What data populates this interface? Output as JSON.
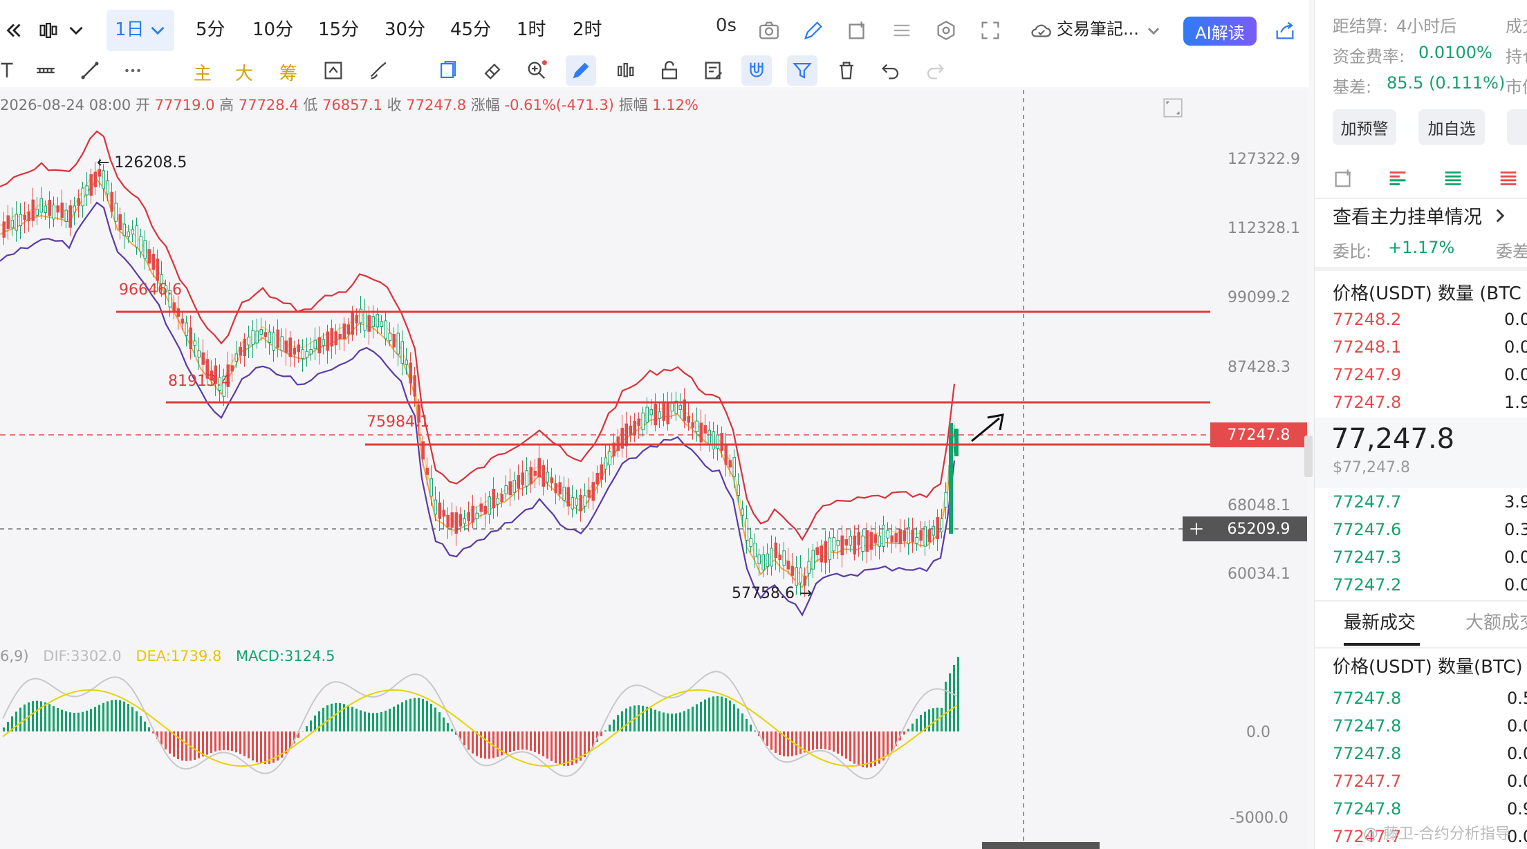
{
  "toolbar": {
    "timeframes": [
      "1日",
      "5分",
      "10分",
      "15分",
      "30分",
      "45分",
      "1时",
      "2时",
      "0s"
    ],
    "active_timeframe": "1日",
    "trade_notes_label": "交易筆記...",
    "ai_button": "AI解读"
  },
  "toolbar2": {
    "indicators": [
      "主",
      "大",
      "筹"
    ]
  },
  "candle_info": {
    "datetime": "2026-08-24 08:00",
    "open_label": "开",
    "open": "77719.0",
    "high_label": "高",
    "high": "77728.4",
    "low_label": "低",
    "low": "76857.1",
    "close_label": "收",
    "close": "77247.8",
    "change_label": "涨幅",
    "change": "-0.61%(-471.3)",
    "amplitude_label": "振幅",
    "amplitude": "1.12%"
  },
  "price_axis": [
    "127322.9",
    "112328.1",
    "99099.2",
    "87428.3",
    "68048.1",
    "60034.1"
  ],
  "price_badges": {
    "current": "77247.8",
    "crosshair": "65209.9"
  },
  "annotations": {
    "high_mark": "← 126208.5",
    "level1": "96646.6",
    "level2": "81913.4",
    "level3": "75984.1",
    "low_mark": "57758.6 →"
  },
  "macd": {
    "params": "6,9)",
    "dif": "DIF:3302.0",
    "dea": "DEA:1739.8",
    "macd": "MACD:3124.5",
    "axis": [
      "0.0",
      "-5000.0"
    ]
  },
  "right_panel": {
    "settlement_label": "距结算:",
    "settlement_value": "4小时后",
    "funding_label": "资金费率:",
    "funding_value": "0.0100%",
    "basis_label": "基差:",
    "basis_value": "85.5 (0.111%)",
    "col_right_labels": [
      "成交",
      "持仓",
      "市值"
    ],
    "buttons": [
      "加预警",
      "加自选"
    ],
    "orderbook_link": "查看主力挂单情况",
    "ratio_label": "委比:",
    "ratio_value": "+1.17%",
    "ratio_right": "委差",
    "ob_header": "价格(USDT) 数量 (BTC",
    "asks": [
      {
        "price": "77248.2",
        "qty": "0.0"
      },
      {
        "price": "77248.1",
        "qty": "0.0"
      },
      {
        "price": "77247.9",
        "qty": "0.0"
      },
      {
        "price": "77247.8",
        "qty": "1.9"
      }
    ],
    "last_price": "77,247.8",
    "last_price_usd": "$77,247.8",
    "bids": [
      {
        "price": "77247.7",
        "qty": "3.9"
      },
      {
        "price": "77247.6",
        "qty": "0.3"
      },
      {
        "price": "77247.3",
        "qty": "0.0"
      },
      {
        "price": "77247.2",
        "qty": "0.0"
      }
    ],
    "tabs": [
      "最新成交",
      "大额成交"
    ],
    "trades_header": "价格(USDT) 数量(BTC)",
    "trades": [
      {
        "price": "77247.8",
        "qty": "0.5",
        "side": "buy"
      },
      {
        "price": "77247.8",
        "qty": "0.0",
        "side": "buy"
      },
      {
        "price": "77247.8",
        "qty": "0.0",
        "side": "buy"
      },
      {
        "price": "77247.7",
        "qty": "0.0",
        "side": "sell"
      },
      {
        "price": "77247.8",
        "qty": "0.9",
        "side": "buy"
      },
      {
        "price": "77247.7",
        "qty": "0.0",
        "side": "sell"
      }
    ],
    "watermark": "@ 藤卫-合约分析指导"
  },
  "colors": {
    "up": "#13a26b",
    "down": "#e54b4b",
    "accent": "#2f7bf5",
    "level_line": "#e03a3a"
  }
}
